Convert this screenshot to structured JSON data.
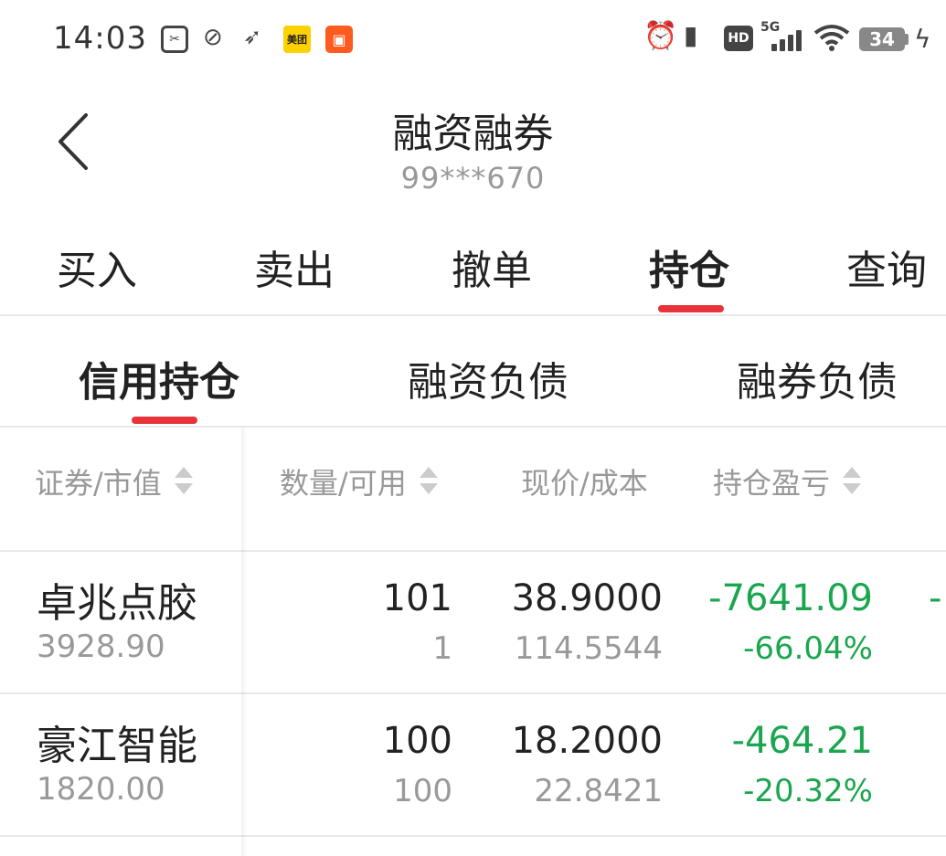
{
  "status_bar": {
    "time": "14:03",
    "meituan_label": "美团",
    "network": "5G",
    "hd": "HD",
    "battery": "34"
  },
  "header": {
    "title": "融资融券",
    "account": "99***670"
  },
  "main_tabs": [
    {
      "label": "买入"
    },
    {
      "label": "卖出"
    },
    {
      "label": "撤单"
    },
    {
      "label": "持仓",
      "active": true
    },
    {
      "label": "查询"
    }
  ],
  "sub_tabs": [
    {
      "label": "信用持仓",
      "active": true
    },
    {
      "label": "融资负债"
    },
    {
      "label": "融券负债"
    }
  ],
  "columns": {
    "security": "证券/市值",
    "quantity": "数量/可用",
    "price": "现价/成本",
    "pnl": "持仓盈亏"
  },
  "rows": [
    {
      "name": "卓兆点胶",
      "market_value": "3928.90",
      "quantity": "101",
      "available": "1",
      "price": "38.9000",
      "cost": "114.5544",
      "pnl": "-7641.09",
      "pnl_pct": "-66.04%"
    },
    {
      "name": "豪江智能",
      "market_value": "1820.00",
      "quantity": "100",
      "available": "100",
      "price": "18.2000",
      "cost": "22.8421",
      "pnl": "-464.21",
      "pnl_pct": "-20.32%"
    }
  ],
  "colors": {
    "accent": "#e8333a",
    "loss": "#1aa64e",
    "muted": "#999999"
  }
}
